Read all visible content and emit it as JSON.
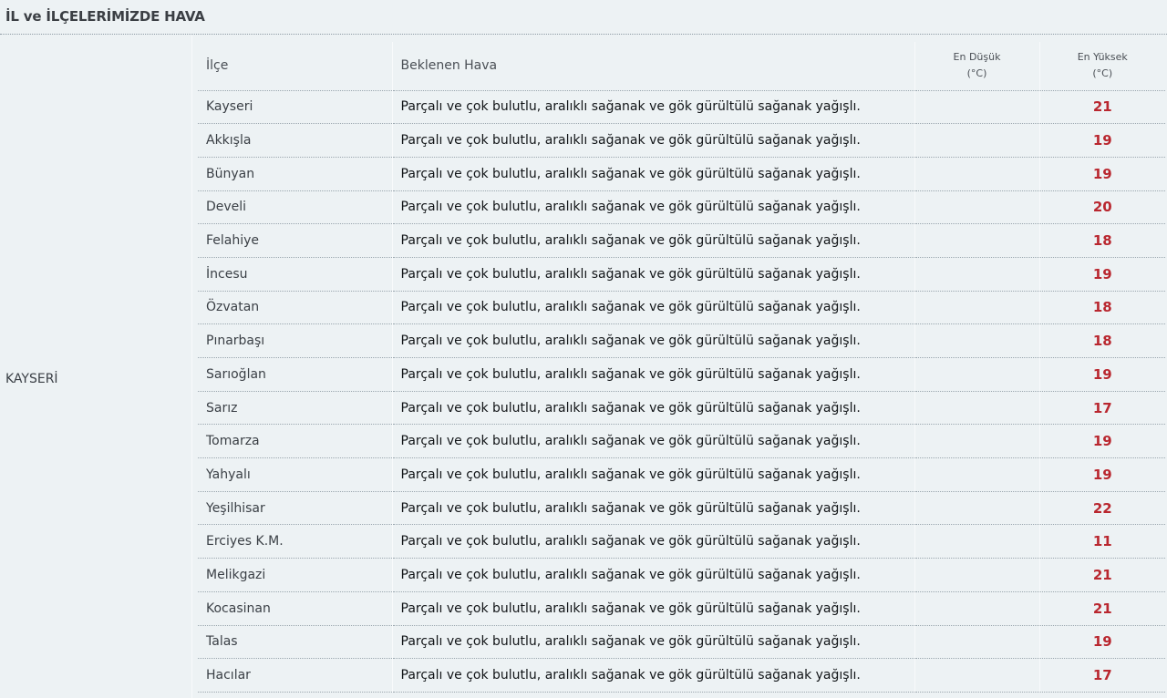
{
  "header": {
    "title": "İL ve İLÇELERİMİZDE HAVA"
  },
  "province": {
    "name": "KAYSERİ"
  },
  "table": {
    "columns": {
      "district": "İlçe",
      "forecast": "Beklenen Hava",
      "low_line1": "En Düşük",
      "low_line2": "(°C)",
      "high_line1": "En Yüksek",
      "high_line2": "(°C)"
    },
    "rows": [
      {
        "district": "Kayseri",
        "forecast": "Parçalı ve çok bulutlu, aralıklı sağanak ve gök gürültülü sağanak yağışlı.",
        "low": "",
        "high": "21"
      },
      {
        "district": "Akkışla",
        "forecast": "Parçalı ve çok bulutlu, aralıklı sağanak ve gök gürültülü sağanak yağışlı.",
        "low": "",
        "high": "19"
      },
      {
        "district": "Bünyan",
        "forecast": "Parçalı ve çok bulutlu, aralıklı sağanak ve gök gürültülü sağanak yağışlı.",
        "low": "",
        "high": "19"
      },
      {
        "district": "Develi",
        "forecast": "Parçalı ve çok bulutlu, aralıklı sağanak ve gök gürültülü sağanak yağışlı.",
        "low": "",
        "high": "20"
      },
      {
        "district": "Felahiye",
        "forecast": "Parçalı ve çok bulutlu, aralıklı sağanak ve gök gürültülü sağanak yağışlı.",
        "low": "",
        "high": "18"
      },
      {
        "district": "İncesu",
        "forecast": "Parçalı ve çok bulutlu, aralıklı sağanak ve gök gürültülü sağanak yağışlı.",
        "low": "",
        "high": "19"
      },
      {
        "district": "Özvatan",
        "forecast": "Parçalı ve çok bulutlu, aralıklı sağanak ve gök gürültülü sağanak yağışlı.",
        "low": "",
        "high": "18"
      },
      {
        "district": "Pınarbaşı",
        "forecast": "Parçalı ve çok bulutlu, aralıklı sağanak ve gök gürültülü sağanak yağışlı.",
        "low": "",
        "high": "18"
      },
      {
        "district": "Sarıoğlan",
        "forecast": "Parçalı ve çok bulutlu, aralıklı sağanak ve gök gürültülü sağanak yağışlı.",
        "low": "",
        "high": "19"
      },
      {
        "district": "Sarız",
        "forecast": "Parçalı ve çok bulutlu, aralıklı sağanak ve gök gürültülü sağanak yağışlı.",
        "low": "",
        "high": "17"
      },
      {
        "district": "Tomarza",
        "forecast": "Parçalı ve çok bulutlu, aralıklı sağanak ve gök gürültülü sağanak yağışlı.",
        "low": "",
        "high": "19"
      },
      {
        "district": "Yahyalı",
        "forecast": "Parçalı ve çok bulutlu, aralıklı sağanak ve gök gürültülü sağanak yağışlı.",
        "low": "",
        "high": "19"
      },
      {
        "district": "Yeşilhisar",
        "forecast": "Parçalı ve çok bulutlu, aralıklı sağanak ve gök gürültülü sağanak yağışlı.",
        "low": "",
        "high": "22"
      },
      {
        "district": "Erciyes K.M.",
        "forecast": "Parçalı ve çok bulutlu, aralıklı sağanak ve gök gürültülü sağanak yağışlı.",
        "low": "",
        "high": "11"
      },
      {
        "district": "Melikgazi",
        "forecast": "Parçalı ve çok bulutlu, aralıklı sağanak ve gök gürültülü sağanak yağışlı.",
        "low": "",
        "high": "21"
      },
      {
        "district": "Kocasinan",
        "forecast": "Parçalı ve çok bulutlu, aralıklı sağanak ve gök gürültülü sağanak yağışlı.",
        "low": "",
        "high": "21"
      },
      {
        "district": "Talas",
        "forecast": "Parçalı ve çok bulutlu, aralıklı sağanak ve gök gürültülü sağanak yağışlı.",
        "low": "",
        "high": "19"
      },
      {
        "district": "Hacılar",
        "forecast": "Parçalı ve çok bulutlu, aralıklı sağanak ve gök gürültülü sağanak yağışlı.",
        "low": "",
        "high": "17"
      }
    ]
  },
  "colors": {
    "background": "#edf2f4",
    "high_temp": "#b9272f",
    "text": "#3a3f45"
  }
}
